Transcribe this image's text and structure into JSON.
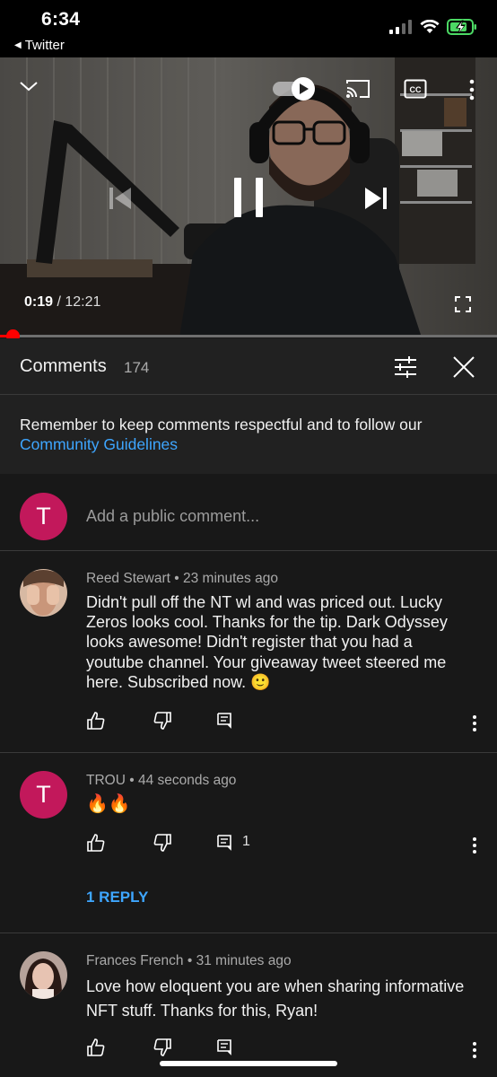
{
  "status_bar": {
    "time": "6:34",
    "back_app": "Twitter",
    "icons": [
      "signal-icon",
      "wifi-icon",
      "battery-charging-icon"
    ],
    "battery_color": "#4cd964"
  },
  "video": {
    "current_time": "0:19",
    "duration": "12:21",
    "progress_fraction": 0.026,
    "autoplay_on": true,
    "icons": [
      "collapse-chevron-icon",
      "autoplay-toggle-icon",
      "cast-icon",
      "captions-icon",
      "more-icon",
      "previous-icon",
      "pause-icon",
      "next-icon",
      "fullscreen-icon"
    ],
    "accent": "#ff0000"
  },
  "comments_header": {
    "title": "Comments",
    "count": "174"
  },
  "guidelines": {
    "text": "Remember to keep comments respectful and to follow our",
    "link": "Community Guidelines"
  },
  "add_comment": {
    "avatar_letter": "T",
    "placeholder": "Add a public comment..."
  },
  "comments": [
    {
      "author": "Reed Stewart",
      "time": "23 minutes ago",
      "text": "Didn't pull off the NT wl and was priced out. Lucky Zeros looks cool. Thanks for the tip. Dark Odyssey looks awesome! Didn't register that you had a youtube channel. Your giveaway tweet steered me here. Subscribed now. 🙂",
      "reply_count": ""
    },
    {
      "author": "TROU",
      "avatar_letter": "T",
      "time": "44 seconds ago",
      "text": "🔥🔥",
      "reply_count": "1",
      "replies_link": "1 REPLY"
    },
    {
      "author": "Frances French",
      "time": "31 minutes ago",
      "text": "Love how eloquent you are when sharing informative NFT stuff. Thanks for this, Ryan!",
      "reply_count": ""
    }
  ],
  "separator": "•"
}
